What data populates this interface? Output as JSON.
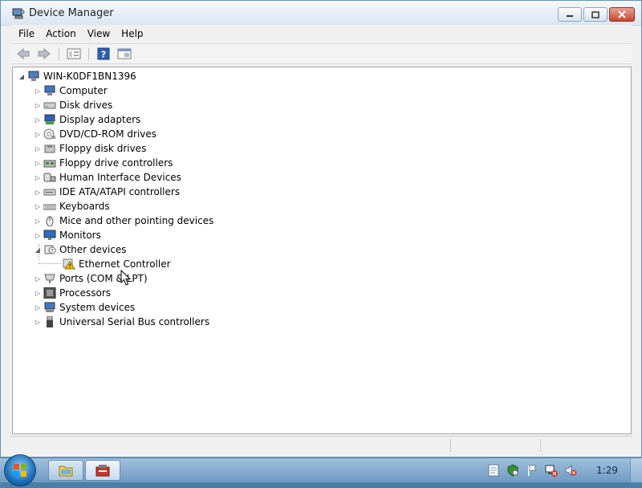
{
  "window": {
    "title": "Device Manager",
    "controls": [
      "minimize",
      "maximize",
      "close"
    ]
  },
  "menu": [
    {
      "label": "File"
    },
    {
      "label": "Action"
    },
    {
      "label": "View"
    },
    {
      "label": "Help"
    }
  ],
  "toolbar": {
    "icons": [
      "back-arrow-icon",
      "forward-arrow-icon",
      "properties-icon",
      "help-icon",
      "console-icon"
    ]
  },
  "tree": {
    "root": "WIN-K0DF1BN1396",
    "items": [
      {
        "label": "Computer",
        "icon": "computer-icon",
        "expanded": false
      },
      {
        "label": "Disk drives",
        "icon": "disk-drive-icon",
        "expanded": false
      },
      {
        "label": "Display adapters",
        "icon": "display-adapter-icon",
        "expanded": false
      },
      {
        "label": "DVD/CD-ROM drives",
        "icon": "dvd-drive-icon",
        "expanded": false
      },
      {
        "label": "Floppy disk drives",
        "icon": "floppy-icon",
        "expanded": false
      },
      {
        "label": "Floppy drive controllers",
        "icon": "floppy-controller-icon",
        "expanded": false
      },
      {
        "label": "Human Interface Devices",
        "icon": "hid-icon",
        "expanded": false
      },
      {
        "label": "IDE ATA/ATAPI controllers",
        "icon": "ide-controller-icon",
        "expanded": false
      },
      {
        "label": "Keyboards",
        "icon": "keyboard-icon",
        "expanded": false
      },
      {
        "label": "Mice and other pointing devices",
        "icon": "mouse-icon",
        "expanded": false
      },
      {
        "label": "Monitors",
        "icon": "monitor-icon",
        "expanded": false
      },
      {
        "label": "Other devices",
        "icon": "unknown-device-icon",
        "expanded": true,
        "children": [
          {
            "label": "Ethernet Controller",
            "icon": "warning-device-icon"
          }
        ]
      },
      {
        "label": "Ports (COM & LPT)",
        "icon": "port-icon",
        "expanded": false
      },
      {
        "label": "Processors",
        "icon": "processor-icon",
        "expanded": false
      },
      {
        "label": "System devices",
        "icon": "system-device-icon",
        "expanded": false
      },
      {
        "label": "Universal Serial Bus controllers",
        "icon": "usb-icon",
        "expanded": false
      }
    ]
  },
  "taskbar": {
    "clock": "1:29",
    "apps": [
      "explorer-icon",
      "device-manager-icon"
    ],
    "tray_icons": [
      "notes-icon",
      "security-center-icon",
      "action-center-flag-icon",
      "network-error-icon",
      "volume-muted-icon"
    ]
  },
  "colors": {
    "taskbar": "#7fa8cf",
    "warning": "#f5c400",
    "close_button": "#c9452d"
  }
}
